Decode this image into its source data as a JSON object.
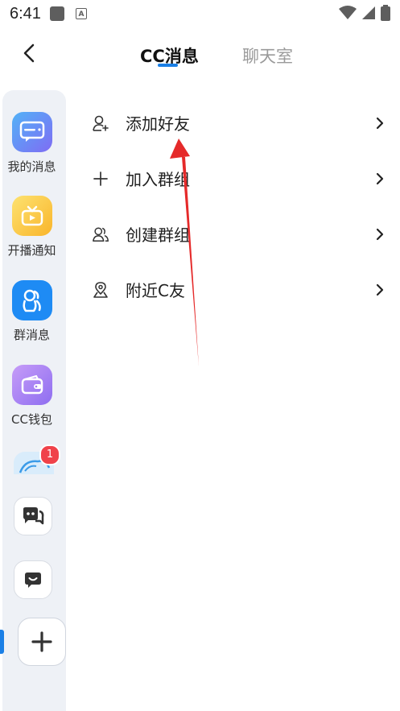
{
  "status_bar": {
    "time": "6:41",
    "notice_letter": "A"
  },
  "header": {
    "tabs": [
      {
        "label": "CC消息",
        "active": true
      },
      {
        "label": "聊天室",
        "active": false
      }
    ],
    "accent_color": "#1a7fe6"
  },
  "sidebar": {
    "items": [
      {
        "label": "我的消息",
        "icon": "message-bubble-icon",
        "color": "#6b82f5"
      },
      {
        "label": "开播通知",
        "icon": "tv-icon",
        "color": "#fbc63a"
      },
      {
        "label": "群消息",
        "icon": "group-people-icon",
        "color": "#1e8bf4"
      },
      {
        "label": "CC钱包",
        "icon": "wallet-icon",
        "color": "#a47df2"
      }
    ],
    "notification_badge": "1",
    "badge_color": "#f0424a"
  },
  "menu": {
    "items": [
      {
        "label": "添加好友",
        "icon": "add-user-icon"
      },
      {
        "label": "加入群组",
        "icon": "plus-icon"
      },
      {
        "label": "创建群组",
        "icon": "group-users-icon"
      },
      {
        "label": "附近C友",
        "icon": "location-pin-icon"
      }
    ]
  }
}
